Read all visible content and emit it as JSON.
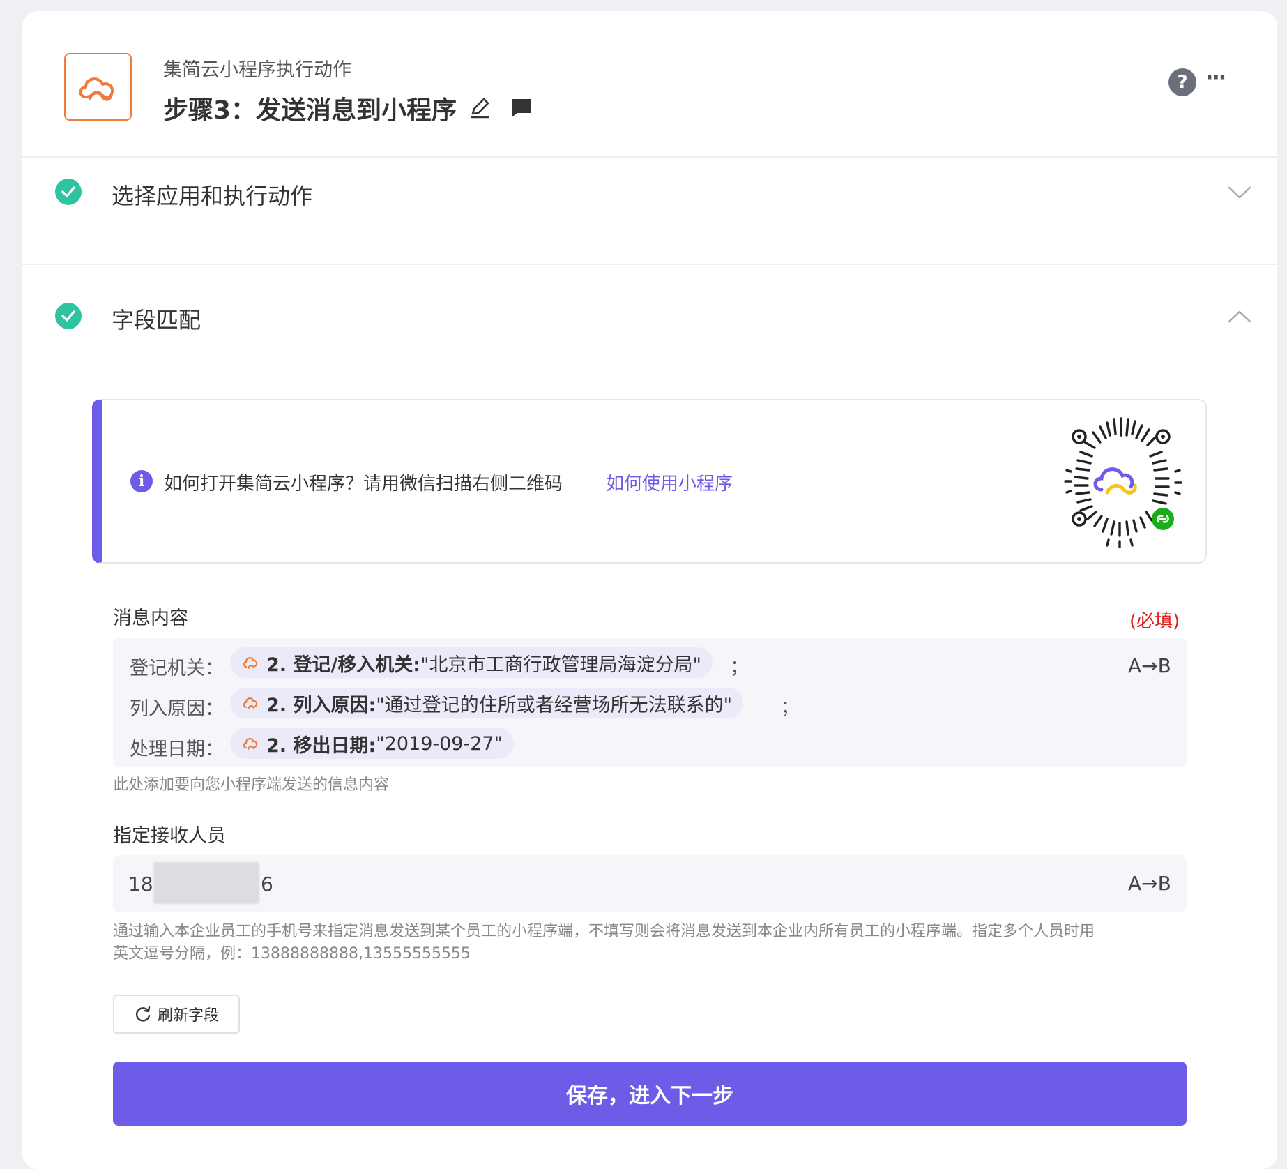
{
  "header": {
    "app_name": "集简云小程序执行动作",
    "step_title": "步骤3：发送消息到小程序",
    "help_label": "?",
    "more_label": "···"
  },
  "sections": {
    "select_app": {
      "title": "选择应用和执行动作",
      "status": "completed",
      "expanded": false
    },
    "field_mapping": {
      "title": "字段匹配",
      "status": "completed",
      "expanded": true
    }
  },
  "info": {
    "text": "如何打开集简云小程序？请用微信扫描右侧二维码",
    "link": "如何使用小程序",
    "icon_label": "i"
  },
  "message_field": {
    "label": "消息内容",
    "required_label": "(必填)",
    "rows": [
      {
        "label": "登记机关：",
        "token_key": "2. 登记/移入机关:",
        "token_value": " \"北京市工商行政管理局海淀分局\"",
        "suffix": "；"
      },
      {
        "label": "列入原因：",
        "token_key": "2. 列入原因:",
        "token_value": " \"通过登记的住所或者经营场所无法联系的\"",
        "suffix": "；"
      },
      {
        "label": "处理日期：",
        "token_key": "2. 移出日期:",
        "token_value": " \"2019-09-27\"",
        "suffix": ""
      }
    ],
    "ab_label": "A→B",
    "hint": "此处添加要向您小程序端发送的信息内容"
  },
  "recipient_field": {
    "label": "指定接收人员",
    "value_start": "18",
    "value_end": "6",
    "ab_label": "A→B",
    "hint_line1": "通过输入本企业员工的手机号来指定消息发送到某个员工的小程序端，不填写则会将消息发送到本企业内所有员工的小程序端。指定多个人员时用",
    "hint_line2": "英文逗号分隔，例：13888888888,13555555555"
  },
  "buttons": {
    "refresh": "刷新字段",
    "save": "保存，进入下一步"
  },
  "colors": {
    "accent": "#6c5ce7",
    "success": "#2ec4a0",
    "brand_orange": "#f07a3c",
    "required": "#e02020"
  }
}
